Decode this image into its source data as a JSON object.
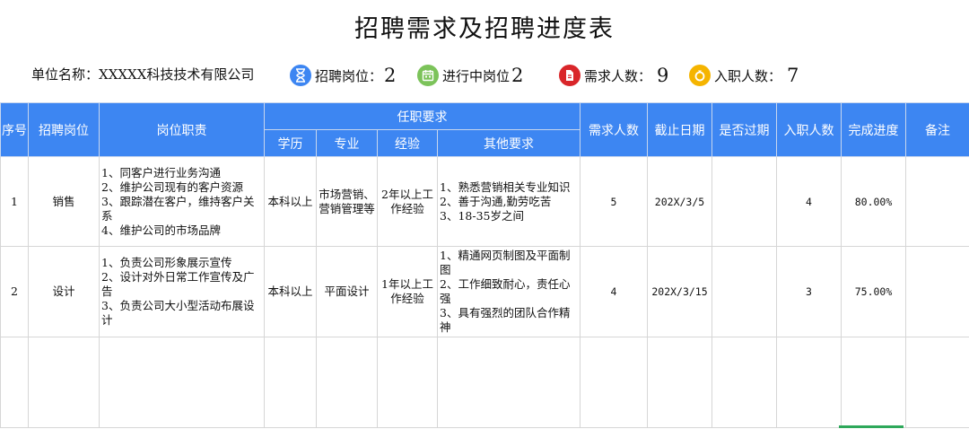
{
  "title": "招聘需求及招聘进度表",
  "info": {
    "company_label": "单位名称：",
    "company_name": "XXXXX科技技术有限公司",
    "positions_label": "招聘岗位：",
    "positions_value": "2",
    "in_progress_label": "进行中岗位",
    "in_progress_value": "2",
    "demand_label": "需求人数：",
    "demand_value": "9",
    "hired_label": "入职人数：",
    "hired_value": "7",
    "colors": {
      "positions": "#3d86f2",
      "in_progress": "#7cc35a",
      "demand": "#d9262a",
      "hired": "#f5b400"
    }
  },
  "table": {
    "headers": {
      "index": "序号",
      "position": "招聘岗位",
      "duty": "岗位职责",
      "requirements": "任职要求",
      "education": "学历",
      "major": "专业",
      "experience": "经验",
      "other": "其他要求",
      "demand": "需求人数",
      "deadline": "截止日期",
      "expired": "是否过期",
      "hired": "入职人数",
      "progress": "完成进度",
      "note": "备注"
    },
    "rows": [
      {
        "index": "1",
        "position": "销售",
        "duty": "1、同客户进行业务沟通\n2、维护公司现有的客户资源\n3、跟踪潜在客户，维持客户关系\n4、维护公司的市场品牌",
        "education": "本科以上",
        "major": "市场营销、营销管理等",
        "experience": "2年以上工作经验",
        "other": "1、熟悉营销相关专业知识\n2、善于沟通,勤劳吃苦\n3、18-35岁之间",
        "demand": "5",
        "deadline": "202X/3/5",
        "expired": "",
        "hired": "4",
        "progress": "80.00%",
        "note": ""
      },
      {
        "index": "2",
        "position": "设计",
        "duty": "1、负责公司形象展示宣传\n2、设计对外日常工作宣传及广告\n3、负责公司大小型活动布展设计",
        "education": "本科以上",
        "major": "平面设计",
        "experience": "1年以上工作经验",
        "other": "1、精通网页制图及平面制图\n2、工作细致耐心，责任心强\n3、具有强烈的团队合作精神",
        "demand": "4",
        "deadline": "202X/3/15",
        "expired": "",
        "hired": "3",
        "progress": "75.00%",
        "note": ""
      }
    ]
  }
}
